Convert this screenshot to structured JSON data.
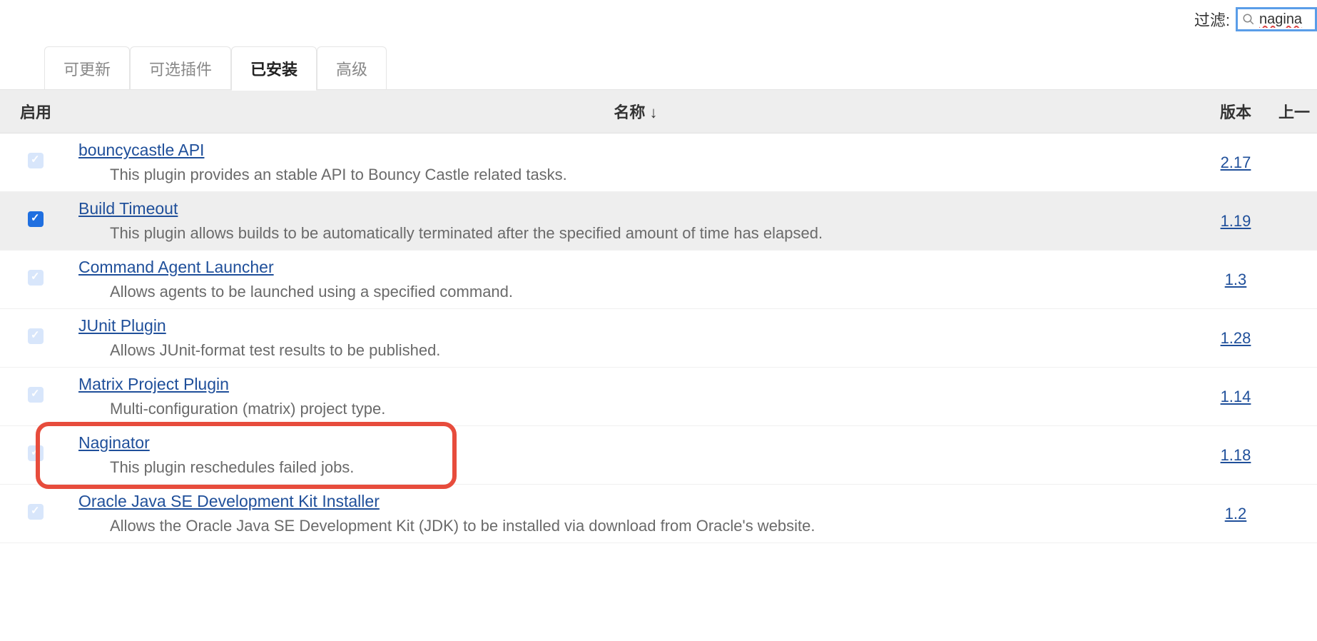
{
  "filter": {
    "label": "过滤:",
    "value": "nagina"
  },
  "tabs": [
    {
      "label": "可更新",
      "active": false
    },
    {
      "label": "可选插件",
      "active": false
    },
    {
      "label": "已安装",
      "active": true
    },
    {
      "label": "高级",
      "active": false
    }
  ],
  "columns": {
    "enable": "启用",
    "name": "名称  ↓",
    "version": "版本",
    "last": "上一"
  },
  "plugins": [
    {
      "name": "bouncycastle API",
      "description": "This plugin provides an stable API to Bouncy Castle related tasks.",
      "version": "2.17",
      "enabled": false,
      "alt": false,
      "highlighted": false
    },
    {
      "name": "Build Timeout",
      "description": "This plugin allows builds to be automatically terminated after the specified amount of time has elapsed.",
      "version": "1.19",
      "enabled": true,
      "alt": true,
      "highlighted": false
    },
    {
      "name": "Command Agent Launcher",
      "description": "Allows agents to be launched using a specified command.",
      "version": "1.3",
      "enabled": false,
      "alt": false,
      "highlighted": false
    },
    {
      "name": "JUnit Plugin",
      "description": "Allows JUnit-format test results to be published.",
      "version": "1.28",
      "enabled": false,
      "alt": false,
      "highlighted": false
    },
    {
      "name": "Matrix Project Plugin",
      "description": "Multi-configuration (matrix) project type.",
      "version": "1.14",
      "enabled": false,
      "alt": false,
      "highlighted": false
    },
    {
      "name": "Naginator",
      "description": "This plugin reschedules failed jobs.",
      "version": "1.18",
      "enabled": false,
      "alt": false,
      "highlighted": true
    },
    {
      "name": "Oracle Java SE Development Kit Installer",
      "description": "Allows the Oracle Java SE Development Kit (JDK) to be installed via download from Oracle's website.",
      "version": "1.2",
      "enabled": false,
      "alt": false,
      "highlighted": false
    }
  ]
}
